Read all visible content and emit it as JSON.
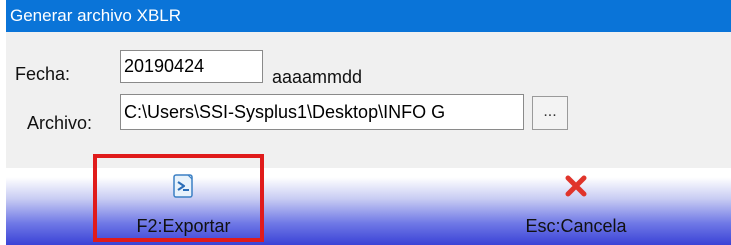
{
  "window": {
    "title": "Generar archivo XBLR"
  },
  "form": {
    "fecha_label": "Fecha:",
    "fecha_value": "20190424",
    "fecha_hint": "aaaammdd",
    "archivo_label": "Archivo:",
    "archivo_value": "C:\\Users\\SSI-Sysplus1\\Desktop\\INFO G",
    "browse_label": "..."
  },
  "toolbar": {
    "export_label": "F2:Exportar",
    "export_icon": "export-icon",
    "cancel_label": "Esc:Cancela",
    "cancel_icon": "close-icon"
  },
  "colors": {
    "titlebar": "#0a74d8",
    "highlight": "#e01b1b",
    "cancel_icon": "#e0342b"
  }
}
